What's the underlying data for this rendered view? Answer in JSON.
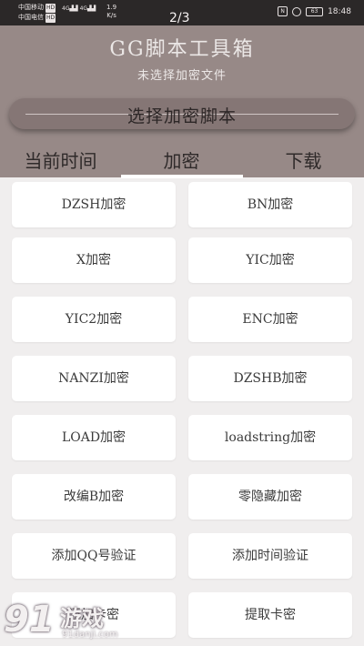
{
  "status_bar": {
    "carrier1": "中国移动",
    "carrier2": "中国电信",
    "hd": "HD",
    "net1": "4G",
    "net2": "4G",
    "speed_value": "1.9",
    "speed_unit": "K/s",
    "page_indicator": "2/3",
    "battery": "63",
    "time": "18:48",
    "nfc": "N"
  },
  "header": {
    "title": "GG脚本工具箱",
    "subtitle": "未选择加密文件",
    "select_button": "选择加密脚本"
  },
  "tabs": [
    "当前时间",
    "加密",
    "下载"
  ],
  "active_tab_index": 1,
  "items": [
    "DZSH加密",
    "BN加密",
    "X加密",
    "YIC加密",
    "YIC2加密",
    "ENC加密",
    "NANZI加密",
    "DZSHB加密",
    "LOAD加密",
    "loadstring加密",
    "改编B加密",
    "零隐藏加密",
    "添加QQ号验证",
    "添加时间验证",
    "添加卡密",
    "提取卡密"
  ],
  "watermark": {
    "logo_number": "91",
    "logo_text": "游戏",
    "url": "91danji.com"
  },
  "colors": {
    "header_bg": "#978987",
    "button_bg": "#857675",
    "page_bg": "#f0eeee",
    "card_bg": "#ffffff"
  }
}
